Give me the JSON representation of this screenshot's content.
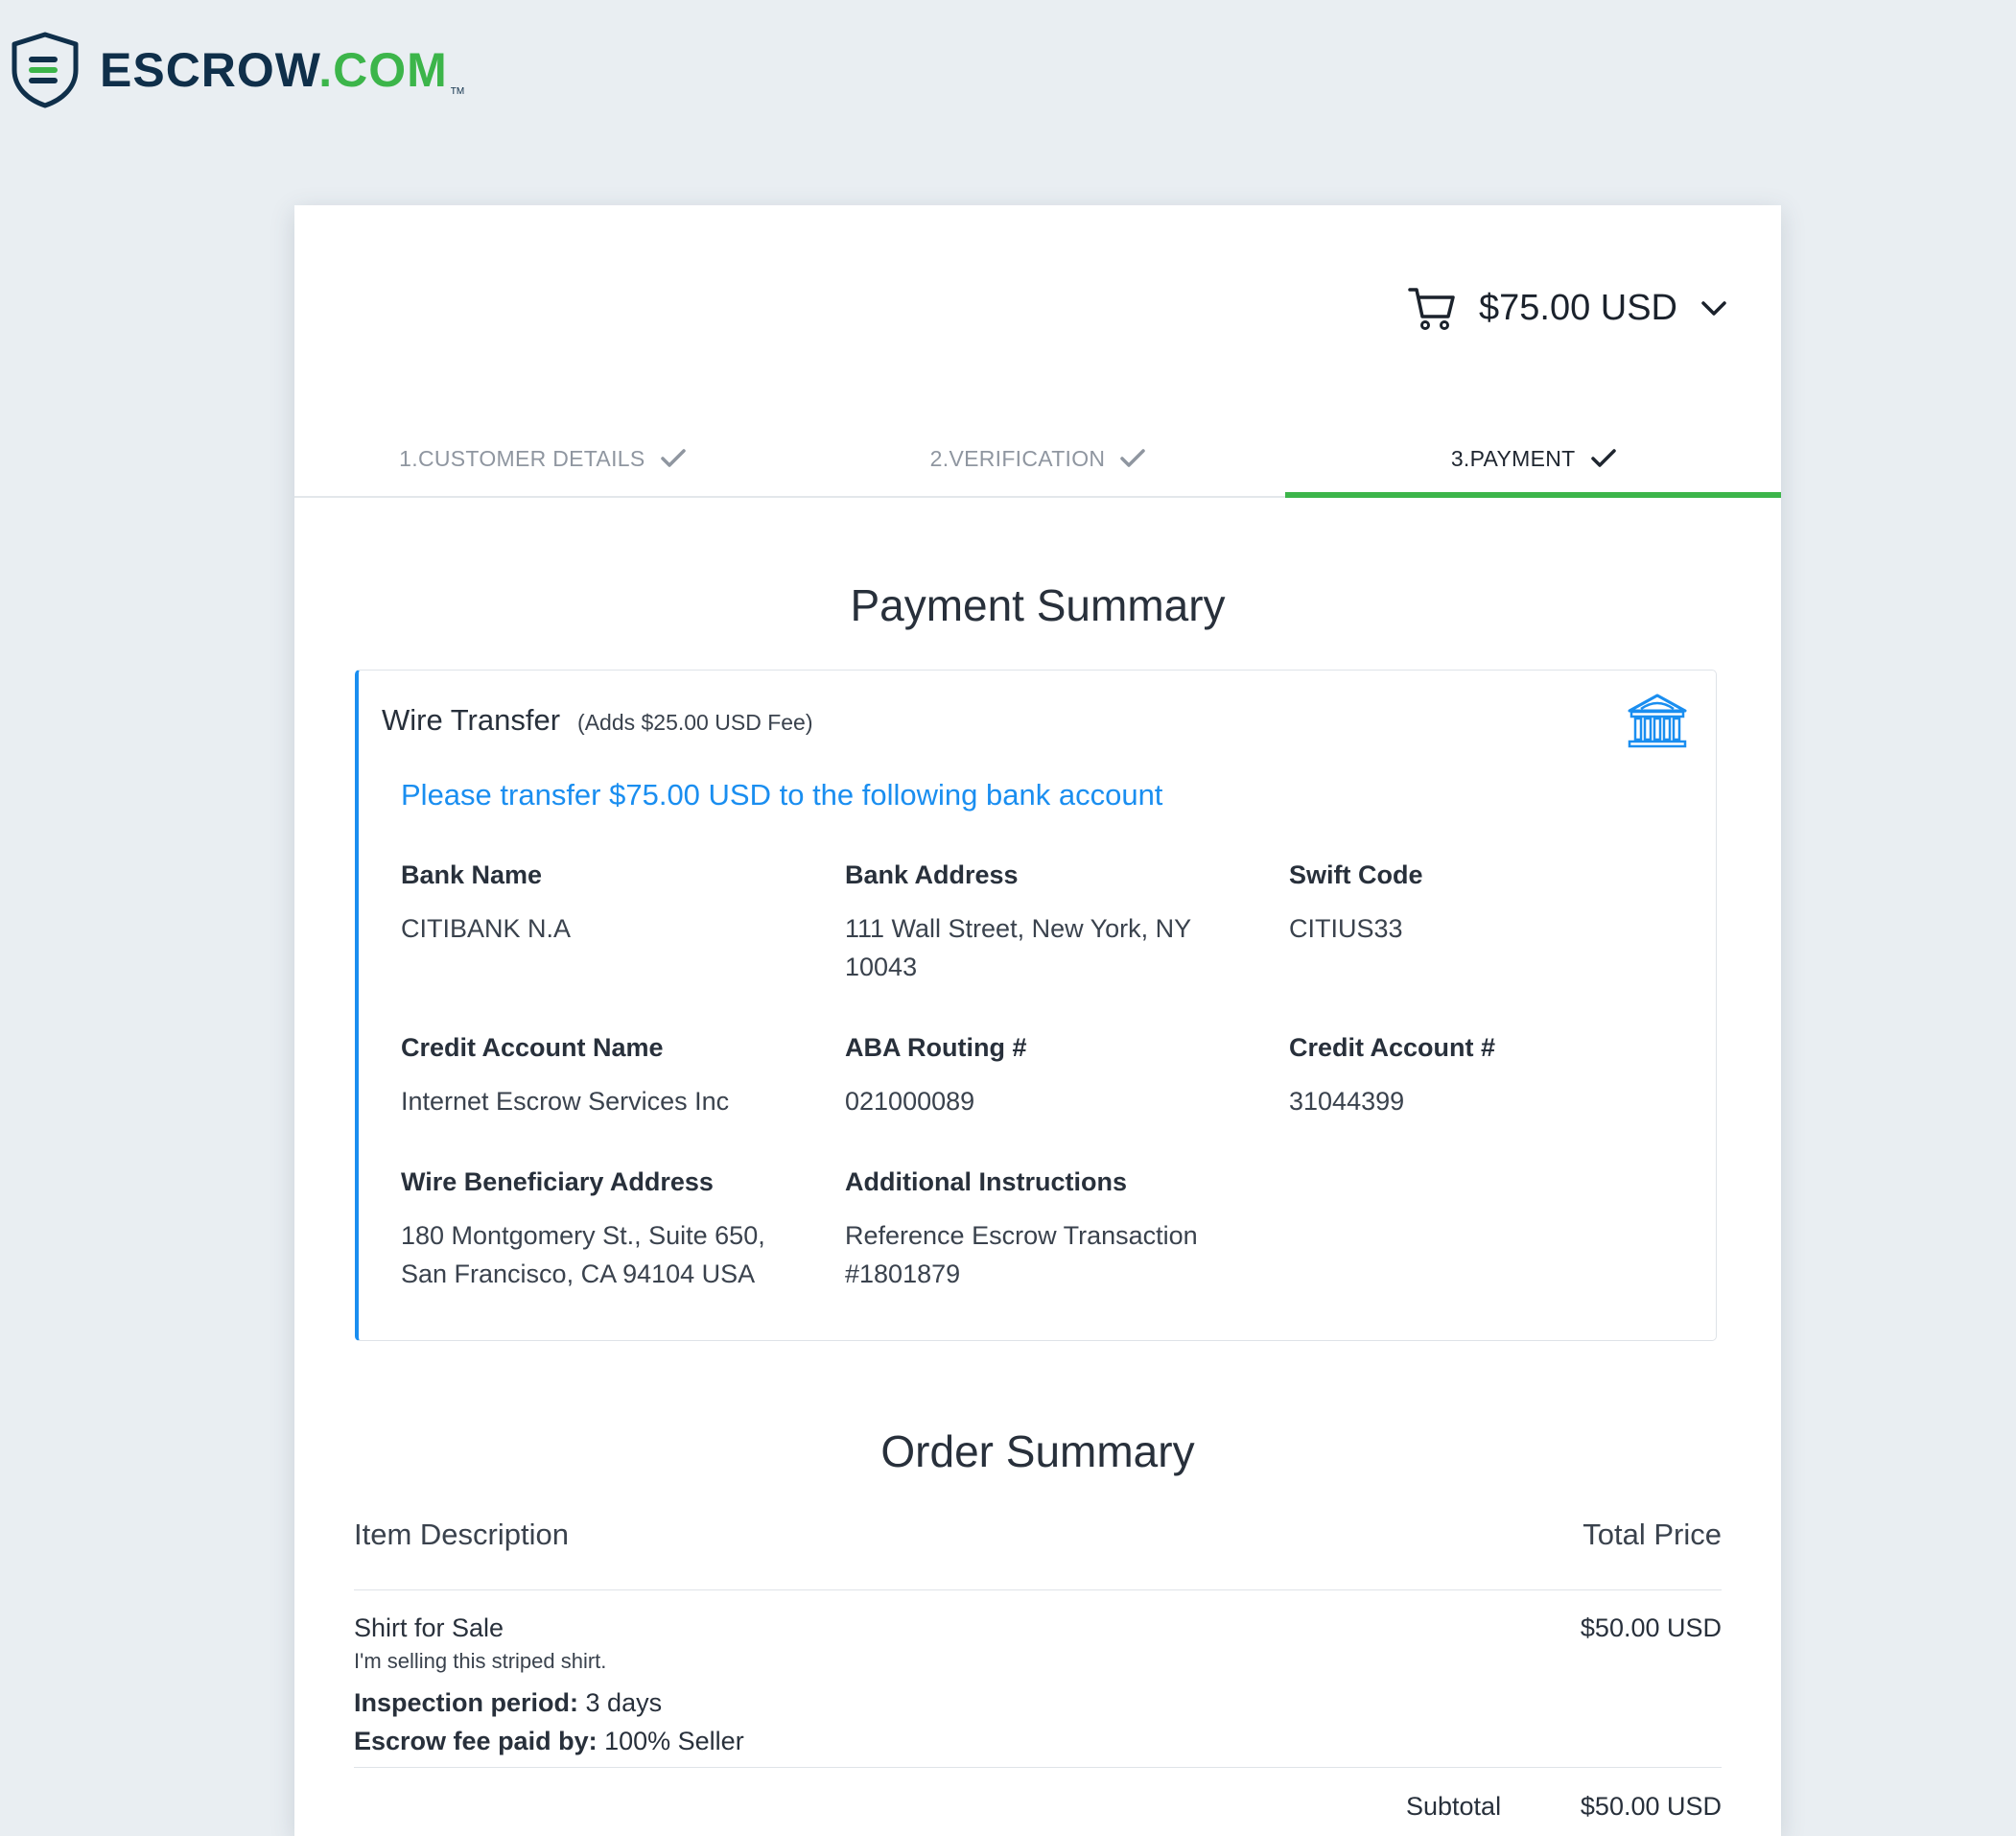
{
  "brand": {
    "name": "ESCROW",
    "tld": ".COM",
    "tm": "TM",
    "accent": "#3cb54a",
    "navy": "#0f2f4a"
  },
  "cart": {
    "icon": "cart-icon",
    "amount": "$75.00 USD",
    "chevron": "chevron-down-icon"
  },
  "steps": [
    {
      "label": "1.CUSTOMER DETAILS",
      "done": true
    },
    {
      "label": "2.VERIFICATION",
      "done": true
    },
    {
      "label": "3.PAYMENT",
      "done": true,
      "active": true
    }
  ],
  "payment_summary": {
    "title": "Payment Summary",
    "method": "Wire Transfer",
    "fee_note": "(Adds $25.00 USD Fee)",
    "instruction": "Please transfer $75.00 USD to the following bank account",
    "icon": "bank-icon",
    "accent": "#1a8ef0",
    "fields": [
      {
        "label": "Bank Name",
        "value": "CITIBANK N.A"
      },
      {
        "label": "Bank Address",
        "value": "111 Wall Street, New York, NY 10043"
      },
      {
        "label": "Swift Code",
        "value": "CITIUS33"
      },
      {
        "label": "Credit Account Name",
        "value": "Internet Escrow Services Inc"
      },
      {
        "label": "ABA Routing #",
        "value": "021000089"
      },
      {
        "label": "Credit Account #",
        "value": "31044399"
      },
      {
        "label": "Wire Beneficiary Address",
        "value": "180 Montgomery St., Suite 650, San Francisco, CA 94104 USA"
      },
      {
        "label": "Additional Instructions",
        "value": "Reference Escrow Transaction #1801879"
      }
    ]
  },
  "order_summary": {
    "title": "Order Summary",
    "col_item": "Item Description",
    "col_price": "Total Price",
    "item": {
      "name": "Shirt for Sale",
      "description": "I'm selling this striped shirt.",
      "inspection_label": "Inspection period:",
      "inspection_value": "3 days",
      "fee_label": "Escrow fee paid by:",
      "fee_value": "100% Seller",
      "price": "$50.00 USD"
    },
    "subtotal_label": "Subtotal",
    "subtotal_value": "$50.00 USD"
  }
}
